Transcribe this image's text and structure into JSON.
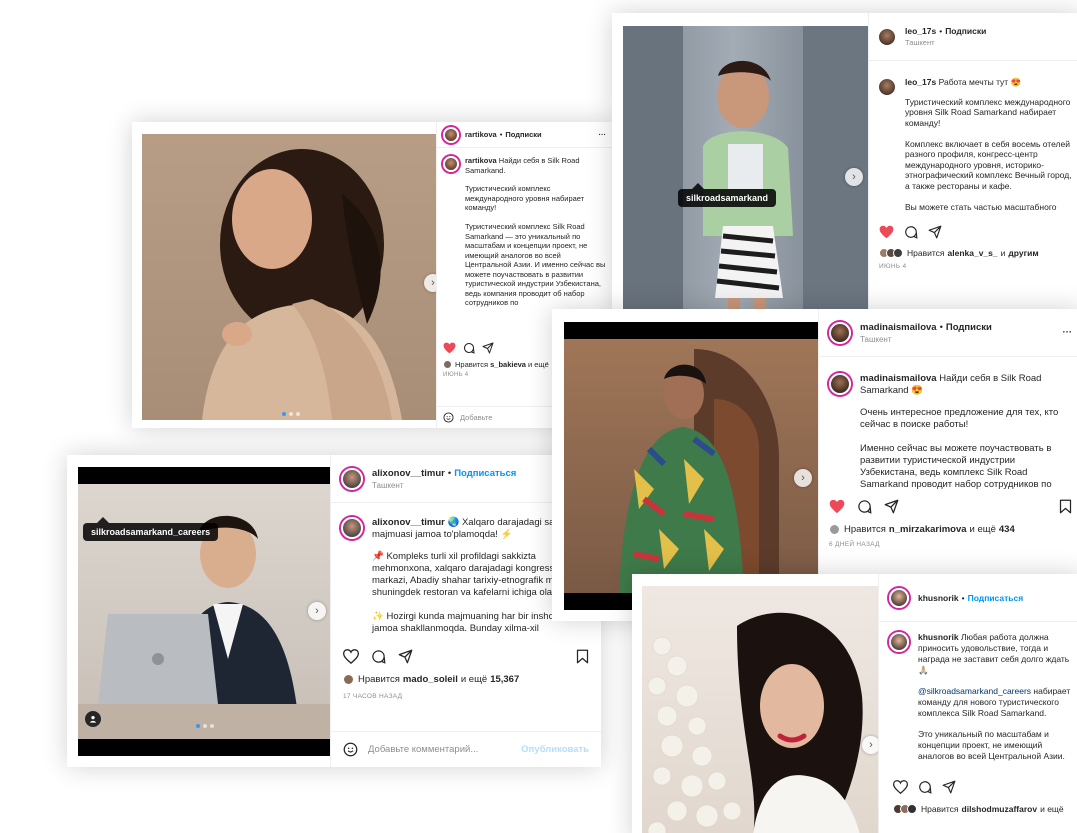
{
  "colors": {
    "link": "#0095f6",
    "heart": "#ed4956",
    "handle_border": "#d6249f"
  },
  "posts": [
    {
      "id": "rartikova",
      "username": "rartikova",
      "follow": "Подписки",
      "caption_user": "rartikova",
      "caption_head": "Найди себя в Silk Road Samarkand.",
      "caption_body": "Туристический комплекс международного уровня набирает команду!\n\nТуристический комплекс Silk Road Samarkand — это уникальный по масштабам и концепции проект, не имеющий аналогов во всей Центральной Азии. И именно сейчас вы можете поучаствовать в развитии туристической индустрии Узбекистана, ведь компания проводит об набор сотрудников по",
      "likes_prefix": "Нравится",
      "likes_user": "s_bakieva",
      "likes_suffix": "и ещё",
      "date": "июнь 4",
      "comment_placeholder": "Добавьте"
    },
    {
      "id": "leo",
      "username": "leo_17s",
      "follow": "Подписки",
      "location": "Ташкент",
      "caption_user": "leo_17s",
      "caption_head": "Работа мечты тут 😍",
      "caption_body": "Туристический комплекс международного уровня Silk Road Samarkand набирает команду!\n\nКомплекс включает в себя восемь отелей разного профиля, конгресс-центр международного уровня, историко-этнографический комплекс Вечный город, а также рестораны и кафе.\n\nВы можете стать частью масштабного",
      "tag": "silkroadsamarkand",
      "likes_prefix": "Нравится",
      "likes_user": "alenka_v_s_",
      "likes_suffix": "и",
      "likes_more": "другим",
      "date": "июнь 4"
    },
    {
      "id": "alixonov",
      "username": "alixonov__timur",
      "follow": "Подписаться",
      "location": "Ташкент",
      "caption_user": "alixonov__timur",
      "caption_head": "🌏 Xalqaro darajadagi sayyohlik majmuasi jamoa to'plamoqda! ⚡",
      "caption_body": "📌 Kompleks turli xil profildagi sakkizta mehmonxona, xalqaro darajadagi kongress markazi, Abadiy shahar tarixiy-etnografik majmuasi, shuningdek restoran va kafelarni ichiga oladi. 🔺\n\n✨ Hozirgi kunda majmuaning har bir inshootida jamoa shakllanmoqda. Bunday xilma-xil",
      "tag": "silkroadsamarkand_careers",
      "likes_prefix": "Нравится",
      "likes_user": "mado_soleil",
      "likes_suffix": "и ещё",
      "likes_count": "15,367",
      "date": "17 часов назад",
      "comment_placeholder": "Добавьте комментарий...",
      "publish": "Опубликовать"
    },
    {
      "id": "madina",
      "username": "madinaismailova",
      "follow": "Подписки",
      "location": "Ташкент",
      "caption_user": "madinaismailova",
      "caption_head": "Найди себя в Silk Road Samarkand 😍",
      "caption_body": "Очень интересное предложение для тех, кто сейчас в поиске работы!\n\nИменно сейчас вы можете поучаствовать в развитии туристической индустрии Узбекистана, ведь комплекс Silk Road Samarkand проводит набор сотрудников по самым разным направлениям и",
      "likes_prefix": "Нравится",
      "likes_user": "n_mirzakarimova",
      "likes_suffix": "и ещё",
      "likes_count": "434",
      "date": "6 дней назад"
    },
    {
      "id": "khusnorik",
      "username": "khusnorik",
      "follow": "Подписаться",
      "caption_user": "khusnorik",
      "caption_head": "Любая работа должна приносить удовольствие, тогда и награда не заставит себя долго ждать🙏🏼",
      "mention": "@silkroadsamarkand_careers",
      "caption_mid": "набирает команду для нового туристического комплекса Silk Road Samarkand.",
      "caption_body": "Это уникальный по масштабам и концепции проект, не имеющий аналогов во всей Центральной Азии.\n\nКто знает, может именно сможете частью",
      "likes_prefix": "Нравится",
      "likes_user": "dilshodmuzaffarov",
      "likes_suffix": "и ещё"
    }
  ]
}
